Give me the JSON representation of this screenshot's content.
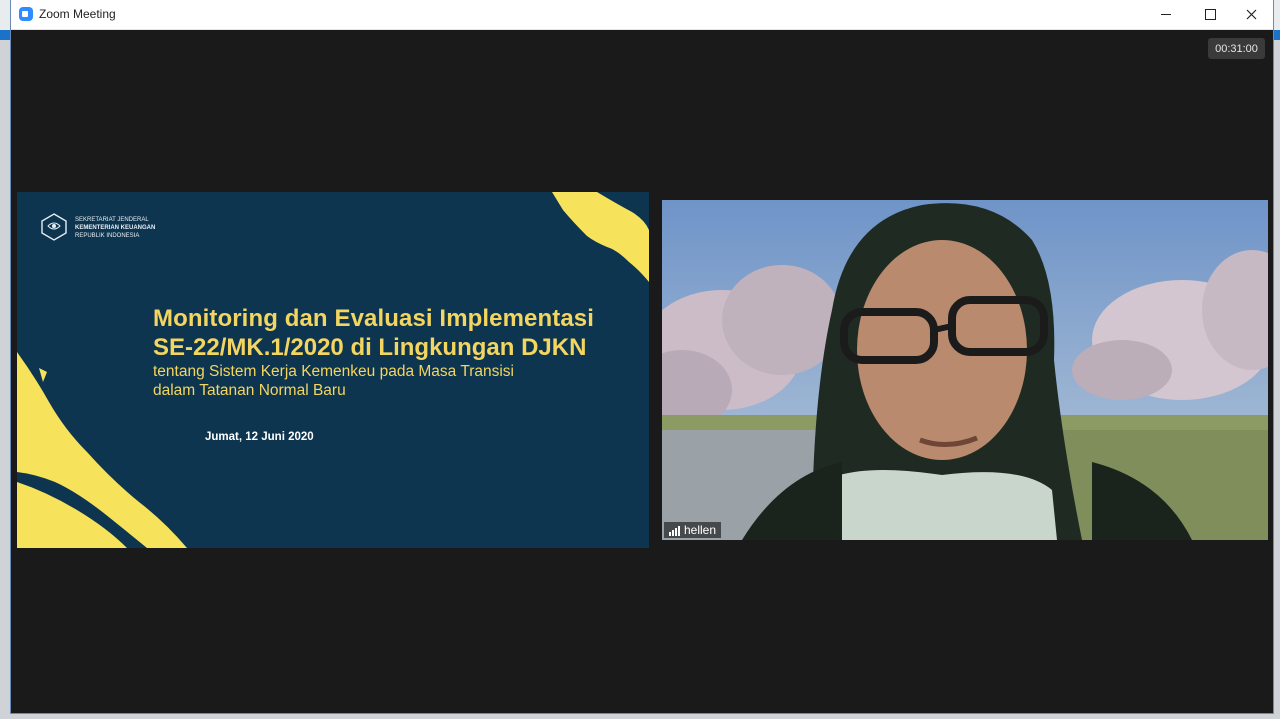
{
  "window": {
    "title": "Zoom Meeting",
    "controls": {
      "minimize": "minimize",
      "maximize": "maximize",
      "close": "close"
    }
  },
  "meeting": {
    "elapsed_time": "00:31:00"
  },
  "shared_screen": {
    "logo": {
      "line1": "SEKRETARIAT JENDERAL",
      "line2": "KEMENTERIAN KEUANGAN",
      "line3": "REPUBLIK INDONESIA"
    },
    "title_line1": "Monitoring dan Evaluasi Implementasi",
    "title_line2": "SE-22/MK.1/2020 di Lingkungan DJKN",
    "subtitle_line1": "tentang Sistem Kerja Kemenkeu pada Masa Transisi",
    "subtitle_line2": "dalam Tatanan Normal Baru",
    "date": "Jumat, 12 Juni 2020",
    "colors": {
      "background": "#0d3550",
      "accent": "#f7e25c"
    }
  },
  "participant": {
    "name": "hellen",
    "signal_icon": "signal-bars-icon"
  }
}
